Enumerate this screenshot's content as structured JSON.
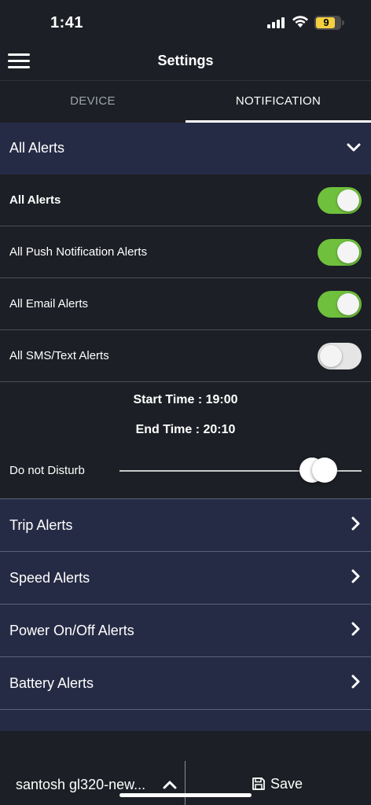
{
  "status_bar": {
    "time": "1:41",
    "battery": "9"
  },
  "header": {
    "title": "Settings"
  },
  "tabs": [
    {
      "label": "DEVICE",
      "active": false
    },
    {
      "label": "NOTIFICATION",
      "active": true
    }
  ],
  "section": {
    "title": "All Alerts"
  },
  "toggles": [
    {
      "label": "All Alerts",
      "on": true
    },
    {
      "label": "All Push Notification Alerts",
      "on": true
    },
    {
      "label": "All Email Alerts",
      "on": true
    },
    {
      "label": "All SMS/Text Alerts",
      "on": false
    }
  ],
  "schedule": {
    "start": "Start Time : 19:00",
    "end": "End Time : 20:10",
    "dnd_label": "Do not Disturb"
  },
  "categories": [
    {
      "label": "Trip Alerts"
    },
    {
      "label": "Speed Alerts"
    },
    {
      "label": "Power On/Off Alerts"
    },
    {
      "label": "Battery Alerts"
    }
  ],
  "footer": {
    "device_name": "santosh gl320-new...",
    "save_label": "Save"
  },
  "colors": {
    "toggle_on": "#6fc03d",
    "section_bg": "#262b45",
    "page_bg": "#1c1f25"
  }
}
